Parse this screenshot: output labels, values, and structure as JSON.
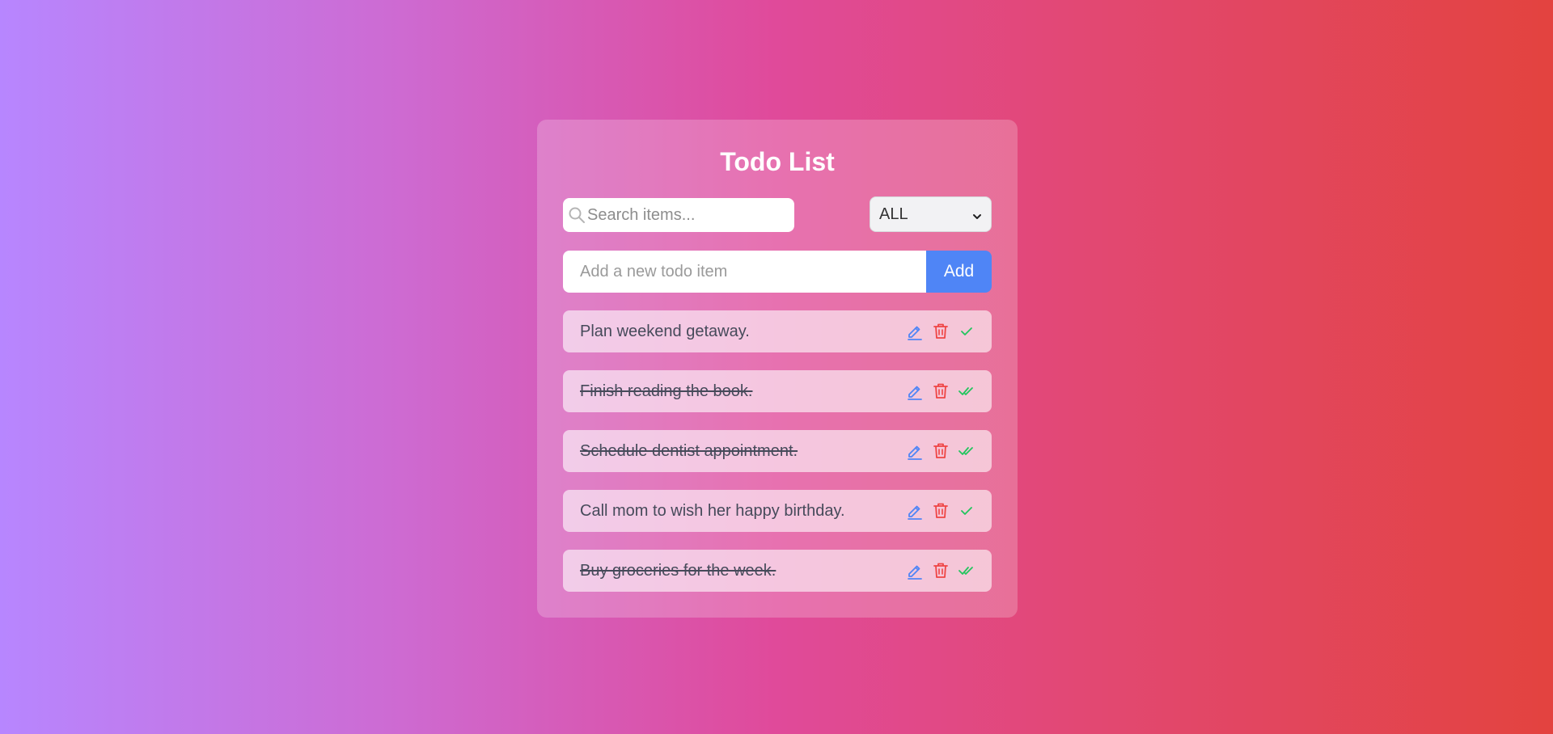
{
  "app": {
    "title": "Todo List"
  },
  "search": {
    "placeholder": "Search items...",
    "value": ""
  },
  "filter": {
    "selected": "ALL"
  },
  "add": {
    "placeholder": "Add a new todo item",
    "button_label": "Add"
  },
  "todos": [
    {
      "text": "Plan weekend getaway.",
      "completed": false
    },
    {
      "text": "Finish reading the book.",
      "completed": true
    },
    {
      "text": "Schedule dentist appointment.",
      "completed": true
    },
    {
      "text": "Call mom to wish her happy birthday.",
      "completed": false
    },
    {
      "text": "Buy groceries for the week.",
      "completed": true
    }
  ],
  "icons": {
    "search": "search-icon",
    "edit": "pencil-icon",
    "delete": "trash-icon",
    "complete": "check-icon",
    "completed": "double-check-icon",
    "dropdown": "chevron-down-icon"
  },
  "colors": {
    "accent": "#4f85f6",
    "edit_icon": "#4f85f6",
    "delete_icon": "#ef4444",
    "check_icon": "#22c55e",
    "gradient_start": "#b786ff",
    "gradient_mid": "#e04a9a",
    "gradient_end": "#e3433f"
  }
}
